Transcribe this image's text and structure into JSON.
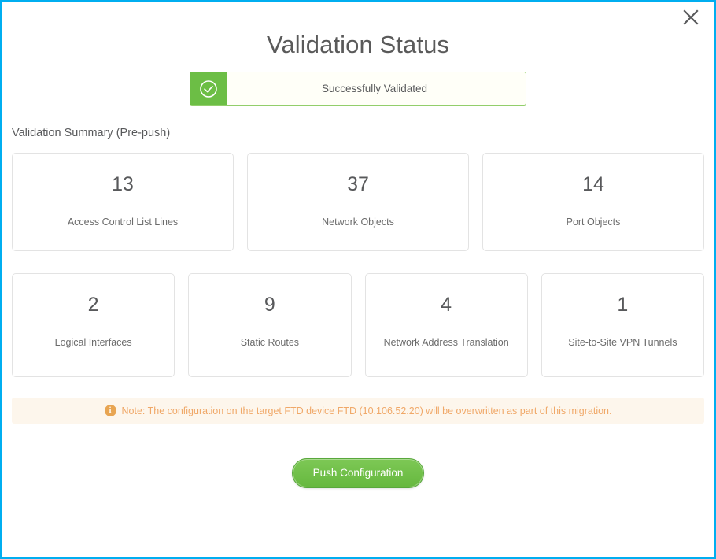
{
  "dialog": {
    "title": "Validation Status",
    "close_icon": "close-icon"
  },
  "status_banner": {
    "icon": "check-circle-icon",
    "text": "Successfully Validated",
    "accent_color": "#6cbe45",
    "border_color": "#92ce6b"
  },
  "summary": {
    "label": "Validation Summary (Pre-push)",
    "rows": [
      [
        {
          "value": "13",
          "label": "Access Control List Lines"
        },
        {
          "value": "37",
          "label": "Network Objects"
        },
        {
          "value": "14",
          "label": "Port Objects"
        }
      ],
      [
        {
          "value": "2",
          "label": "Logical Interfaces"
        },
        {
          "value": "9",
          "label": "Static Routes"
        },
        {
          "value": "4",
          "label": "Network Address Translation"
        },
        {
          "value": "1",
          "label": "Site-to-Site VPN Tunnels"
        }
      ]
    ]
  },
  "note": {
    "icon": "info-icon",
    "icon_glyph": "i",
    "text": "Note: The configuration on the target FTD device FTD (10.106.52.20) will be overwritten as part of this migration.",
    "text_color": "#f0a868",
    "background_color": "#fdf6ec"
  },
  "footer": {
    "push_label": "Push Configuration",
    "push_color": "#6cbe45"
  },
  "theme": {
    "dialog_border_color": "#00aef0"
  }
}
